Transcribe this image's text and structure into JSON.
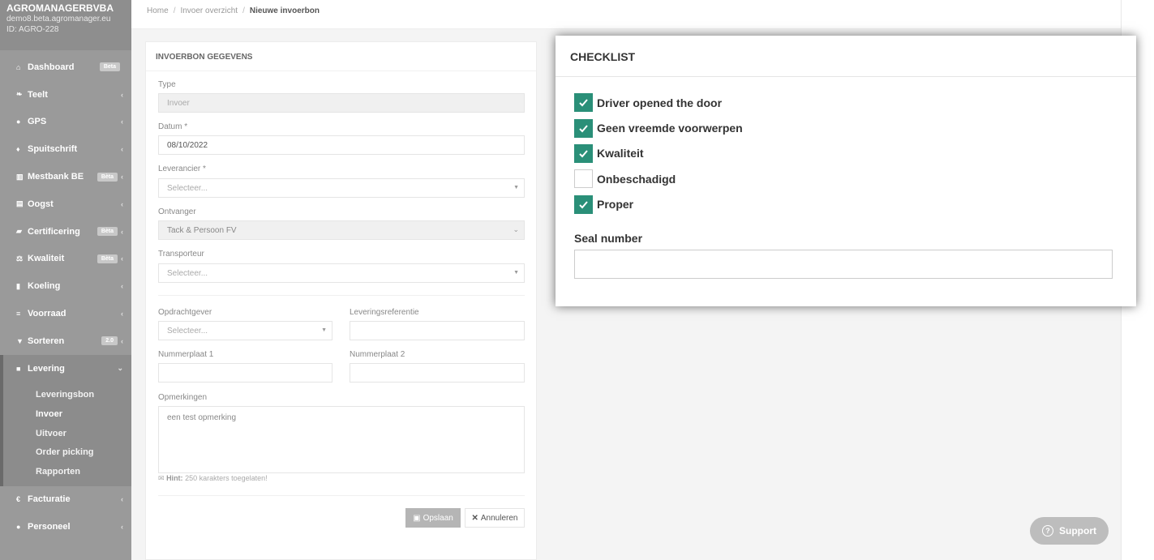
{
  "brand": {
    "org": "AGROMANAGERBVBA",
    "domain": "demo8.beta.agromanager.eu",
    "id": "ID: AGRO-228"
  },
  "sidebar": {
    "items": [
      {
        "icon": "home-icon",
        "glyph": "⌂",
        "label": "Dashboard",
        "badge": "Beta",
        "chevron": ""
      },
      {
        "icon": "leaf-icon",
        "glyph": "❧",
        "label": "Teelt",
        "badge": "",
        "chevron": "‹"
      },
      {
        "icon": "map-pin-icon",
        "glyph": "●",
        "label": "GPS",
        "badge": "",
        "chevron": "‹"
      },
      {
        "icon": "drop-icon",
        "glyph": "♦",
        "label": "Spuitschrift",
        "badge": "",
        "chevron": "‹"
      },
      {
        "icon": "bank-icon",
        "glyph": "▥",
        "label": "Mestbank BE",
        "badge": "Bèta",
        "chevron": "‹"
      },
      {
        "icon": "basket-icon",
        "glyph": "▤",
        "label": "Oogst",
        "badge": "",
        "chevron": "‹"
      },
      {
        "icon": "certificate-icon",
        "glyph": "▰",
        "label": "Certificering",
        "badge": "Bèta",
        "chevron": "‹"
      },
      {
        "icon": "balance-icon",
        "glyph": "⚖",
        "label": "Kwaliteit",
        "badge": "Bèta",
        "chevron": "‹"
      },
      {
        "icon": "thermometer-icon",
        "glyph": "▮",
        "label": "Koeling",
        "badge": "",
        "chevron": "‹"
      },
      {
        "icon": "list-icon",
        "glyph": "≡",
        "label": "Voorraad",
        "badge": "",
        "chevron": "‹"
      },
      {
        "icon": "filter-icon",
        "glyph": "▼",
        "label": "Sorteren",
        "badge": "2.0",
        "chevron": "‹"
      }
    ],
    "active": {
      "icon": "truck-icon",
      "glyph": "■",
      "label": "Levering",
      "chevron": "⌄"
    },
    "subitems": [
      "Leveringsbon",
      "Invoer",
      "Uitvoer",
      "Order picking",
      "Rapporten"
    ],
    "bottom": [
      {
        "icon": "euro-icon",
        "glyph": "€",
        "label": "Facturatie",
        "chevron": "‹"
      },
      {
        "icon": "user-icon",
        "glyph": "●",
        "label": "Personeel",
        "chevron": "‹"
      }
    ]
  },
  "breadcrumb": {
    "home": "Home",
    "parent": "Invoer overzicht",
    "current": "Nieuwe invoerbon"
  },
  "form": {
    "title": "INVOERBON GEGEVENS",
    "type_label": "Type",
    "type_value": "Invoer",
    "datum_label": "Datum *",
    "datum_value": "08/10/2022",
    "leverancier_label": "Leverancier *",
    "leverancier_value": "Selecteer...",
    "ontvanger_label": "Ontvanger",
    "ontvanger_value": "Tack & Persoon FV",
    "transporteur_label": "Transporteur",
    "transporteur_value": "Selecteer...",
    "opdrachtgever_label": "Opdrachtgever",
    "opdrachtgever_value": "Selecteer...",
    "referentie_label": "Leveringsreferentie",
    "nummerplaat1_label": "Nummerplaat 1",
    "nummerplaat2_label": "Nummerplaat 2",
    "opmerkingen_label": "Opmerkingen",
    "opmerkingen_value": "een test opmerking",
    "hint_bold": "Hint:",
    "hint_text": "250 karakters toegelaten!",
    "save_label": "Opslaan",
    "cancel_label": "Annuleren"
  },
  "checklist": {
    "title": "CHECKLIST",
    "items": [
      {
        "label": "Driver opened the door",
        "checked": true
      },
      {
        "label": "Geen vreemde voorwerpen",
        "checked": true
      },
      {
        "label": "Kwaliteit",
        "checked": true
      },
      {
        "label": "Onbeschadigd",
        "checked": false
      },
      {
        "label": "Proper",
        "checked": true
      }
    ],
    "seal_label": "Seal number",
    "seal_value": ""
  },
  "support": {
    "label": "Support"
  },
  "colors": {
    "accent": "#2a8f78",
    "sidebar": "#9a9a9a"
  }
}
